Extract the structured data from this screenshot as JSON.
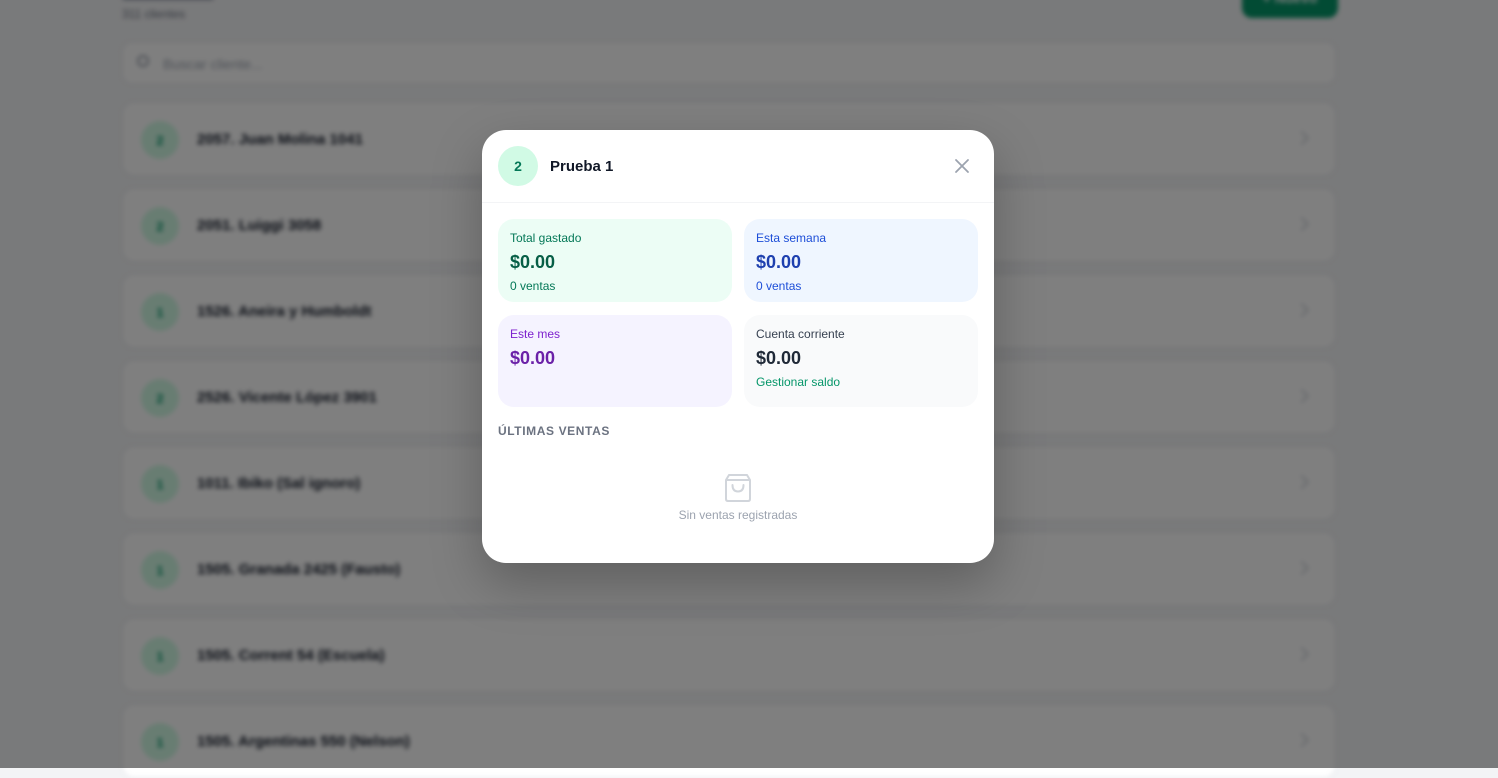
{
  "background": {
    "subtitle": "311 clientes",
    "new_button_label": "+ Nuevo",
    "search_placeholder": "Buscar cliente...",
    "rows": [
      {
        "initial": "2",
        "name": "2057. Juan Molina 1041"
      },
      {
        "initial": "2",
        "name": "2051. Luiggi 3058"
      },
      {
        "initial": "1",
        "name": "1526. Aneira y Humboldt"
      },
      {
        "initial": "2",
        "name": "2526. Vicente López 3901"
      },
      {
        "initial": "1",
        "name": "1011. Ibiko (Sal ignoro)"
      },
      {
        "initial": "1",
        "name": "1505. Granada 2425 (Fausto)"
      },
      {
        "initial": "1",
        "name": "1505. Corrent 54 (Escuela)"
      },
      {
        "initial": "1",
        "name": "1505. Argentinas 550 (Nelson)"
      }
    ]
  },
  "modal": {
    "avatar_initial": "2",
    "client_name": "Prueba 1",
    "close_icon": "close-icon",
    "stats": {
      "total": {
        "label": "Total gastado",
        "value": "$0.00",
        "sub": "0 ventas"
      },
      "week": {
        "label": "Esta semana",
        "value": "$0.00",
        "sub": "0 ventas"
      },
      "month": {
        "label": "Este mes",
        "value": "$0.00"
      },
      "account": {
        "label": "Cuenta corriente",
        "value": "$0.00",
        "link": "Gestionar saldo"
      }
    },
    "recent_sales_title": "ÚLTIMAS VENTAS",
    "empty_icon": "shopping-bag-icon",
    "empty_text": "Sin ventas registradas"
  },
  "colors": {
    "accent": "#059669",
    "overlay": "rgba(0,0,0,0.5)"
  }
}
